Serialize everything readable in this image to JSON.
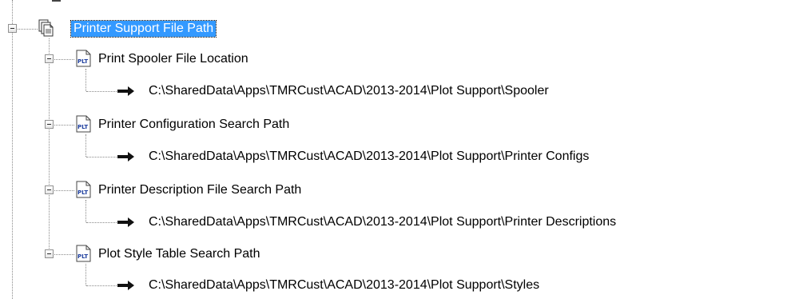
{
  "tree": {
    "root": {
      "label": "Printer Support File Path",
      "icon": "stacked-documents-icon",
      "expanded": true,
      "selected": true
    },
    "nodes": [
      {
        "label": "Print Spooler File Location",
        "icon": "plt-file-icon",
        "icon_text": "PLT",
        "path": "C:\\SharedData\\Apps\\TMRCust\\ACAD\\2013-2014\\Plot Support\\Spooler"
      },
      {
        "label": "Printer Configuration Search Path",
        "icon": "plt-file-icon",
        "icon_text": "PLT",
        "path": "C:\\SharedData\\Apps\\TMRCust\\ACAD\\2013-2014\\Plot Support\\Printer Configs"
      },
      {
        "label": "Printer Description File Search Path",
        "icon": "plt-file-icon",
        "icon_text": "PLT",
        "path": "C:\\SharedData\\Apps\\TMRCust\\ACAD\\2013-2014\\Plot Support\\Printer Descriptions"
      },
      {
        "label": "Plot Style Table Search Path",
        "icon": "plt-file-icon",
        "icon_text": "PLT",
        "path": "C:\\SharedData\\Apps\\TMRCust\\ACAD\\2013-2014\\Plot Support\\Styles"
      }
    ]
  },
  "colors": {
    "selection": "#3399ff",
    "connector": "#8a8a8a",
    "plt_icon_text": "#1f3f9f"
  }
}
